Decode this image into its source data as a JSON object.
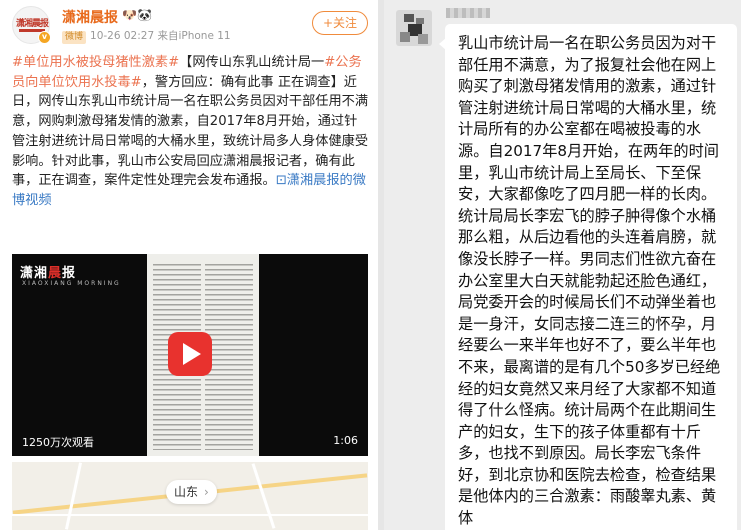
{
  "post": {
    "user_name": "潇湘晨报",
    "name_icons": "🐶🐼",
    "vip_tag": "微博",
    "meta": "10-26 02:27  来自iPhone 11",
    "follow_label": "+关注",
    "avatar_text": "潇湘晨报",
    "verify_mark": "v",
    "text_segments": [
      {
        "type": "topic",
        "text": "#单位用水被投母猪性激素#"
      },
      {
        "type": "plain",
        "text": "【网传山东乳山统计局一"
      },
      {
        "type": "topic",
        "text": "#公务员向单位饮用水投毒#"
      },
      {
        "type": "plain",
        "text": "，警方回应：确有此事 正在调查】近日，网传山东乳山市统计局一名在职公务员因对干部任用不满意，网购刺激母猪发情的激素，自2017年8月开始，通过针管注射进统计局日常喝的大桶水里，致统计局多人身体健康受影响。针对此事，乳山市公安局回应潇湘晨报记者，确有此事，正在调查，案件定性处理完会发布通报。"
      },
      {
        "type": "link",
        "text": "⊡潇湘晨报的微博视频"
      }
    ]
  },
  "video": {
    "brand_main": "潇湘",
    "brand_red": "晨",
    "brand_end": "报",
    "brand_sub": "XIAOXIANG MORNING",
    "views": "1250万次观看",
    "duration": "1:06"
  },
  "map": {
    "location_label": "山东",
    "chevron": "›"
  },
  "chat": {
    "message": "乳山市统计局一名在职公务员因为对干部任用不满意，为了报复社会他在网上购买了刺激母猪发情用的激素，通过针管注射进统计局日常喝的大桶水里，统计局所有的办公室都在喝被投毒的水源。自2017年8月开始，在两年的时间里，乳山市统计局上至局长、下至保安，大家都像吃了四月肥一样的长肉。统计局局长李宏飞的脖子肿得像个水桶那么粗，从后边看他的头连着肩膀，就像没长脖子一样。男同志们性欲亢奋在办公室里大白天就能勃起还脸色通红，局党委开会的时候局长们不动弹坐着也是一身汗，女同志接二连三的怀孕，月经要么一来半年也好不了，要么半年也不来，最离谱的是有几个50多岁已经绝经的妇女竟然又来月经了大家都不知道得了什么怪病。统计局两个在此期间生产的妇女，生下的孩子体重都有十斤多，也找不到原因。局长李宏飞条件好，到北京协和医院去检查，检查结果是他体内的三合激素：雨酸睾丸素、黄体"
  },
  "colors": {
    "topic": "#eb7350",
    "link": "#3a7ac4",
    "brand_orange": "#e86a1c",
    "play_red": "#e8322e"
  }
}
